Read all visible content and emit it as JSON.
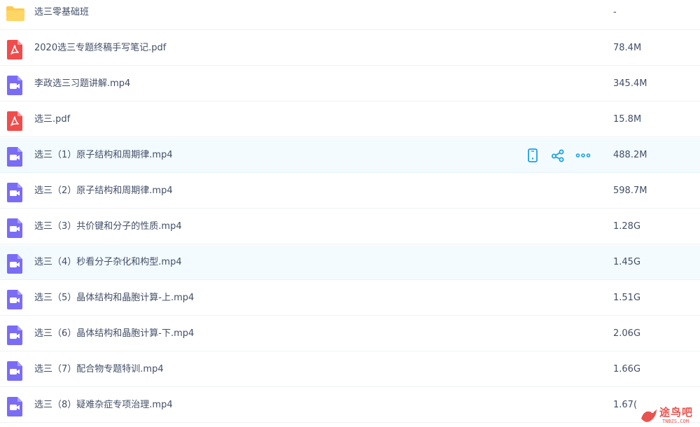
{
  "files": [
    {
      "type": "folder",
      "name": "选三零基础班",
      "size": "-"
    },
    {
      "type": "pdf",
      "name": "2020选三专题终稿手写笔记.pdf",
      "size": "78.4M"
    },
    {
      "type": "video",
      "name": "李政选三习题讲解.mp4",
      "size": "345.4M"
    },
    {
      "type": "pdf",
      "name": "选三.pdf",
      "size": "15.8M"
    },
    {
      "type": "video",
      "name": "选三（1）原子结构和周期律.mp4",
      "size": "488.2M",
      "hover": true
    },
    {
      "type": "video",
      "name": "选三（2）原子结构和周期律.mp4",
      "size": "598.7M"
    },
    {
      "type": "video",
      "name": "选三（3）共价键和分子的性质.mp4",
      "size": "1.28G"
    },
    {
      "type": "video",
      "name": "选三（4）秒看分子杂化和构型.mp4",
      "size": "1.45G",
      "highlight": true
    },
    {
      "type": "video",
      "name": "选三（5）晶体结构和晶胞计算-上.mp4",
      "size": "1.51G"
    },
    {
      "type": "video",
      "name": "选三（6）晶体结构和晶胞计算-下.mp4",
      "size": "2.06G"
    },
    {
      "type": "video",
      "name": "选三（7）配合物专题特训.mp4",
      "size": "1.66G"
    },
    {
      "type": "video",
      "name": "选三（8）疑难杂症专项治理.mp4",
      "size": "1.67("
    }
  ],
  "row_actions": [
    "phone-icon",
    "share-icon",
    "more-icon"
  ],
  "colors": {
    "folder": "#ffc94d",
    "pdf": "#f04c4c",
    "video": "#7b6cf5",
    "accent": "#1aa1e8",
    "highlight_bg": "#f4fbff",
    "watermark": "#e8534f"
  },
  "watermark": {
    "text": "途鸟吧",
    "sub": "TNBZS.COM"
  }
}
